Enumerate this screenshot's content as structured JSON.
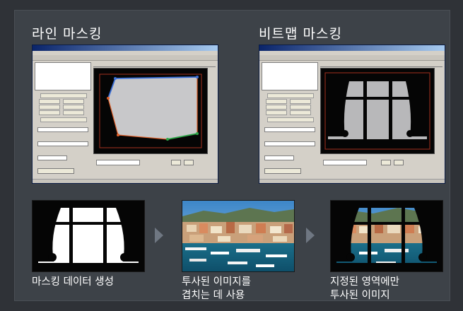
{
  "titles": {
    "line_masking": "라인 마스킹",
    "bitmap_masking": "비트맵 마스킹"
  },
  "captions": {
    "step1": "마스킹 데이터 생성",
    "step2_line1": "투사된 이미지를",
    "step2_line2": "겹치는 데 사용",
    "step3_line1": "지정된 영역에만",
    "step3_line2": "투사된 이미지"
  },
  "colors": {
    "background": "#2f3237",
    "panel": "#3d4248",
    "mask_gray": "#c8c8ca",
    "line_blue": "#3a6fd8",
    "point_orange": "#e0602a",
    "line_green": "#2ea84a",
    "arrow": "#6f7782"
  },
  "icons": [
    "chevron-right-icon",
    "chevron-right-icon"
  ]
}
